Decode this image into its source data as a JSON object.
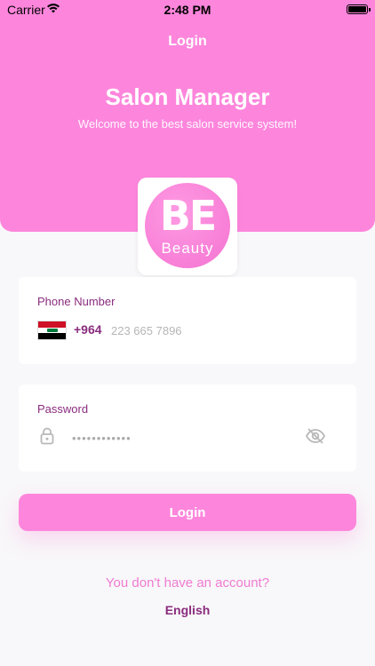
{
  "status_bar": {
    "carrier": "Carrier",
    "time": "2:48 PM"
  },
  "header": {
    "nav_title": "Login",
    "app_title": "Salon Manager",
    "subtitle": "Welcome to the best salon service system!"
  },
  "logo": {
    "mark": "BE",
    "word": "Beauty"
  },
  "phone": {
    "label": "Phone Number",
    "dial_code": "+964",
    "placeholder": "223 665 7896",
    "flag_icon": "iraq-flag-icon"
  },
  "password": {
    "label": "Password",
    "placeholder": "••••••••••••",
    "lock_icon": "lock-icon",
    "toggle_icon": "eye-slash-icon"
  },
  "actions": {
    "login_label": "Login",
    "signup_label": "You don't have an account?",
    "language_label": "English"
  },
  "colors": {
    "brand_pink": "#fd86dc",
    "accent_purple": "#8a2c7e",
    "link_pink": "#f07bd2"
  }
}
